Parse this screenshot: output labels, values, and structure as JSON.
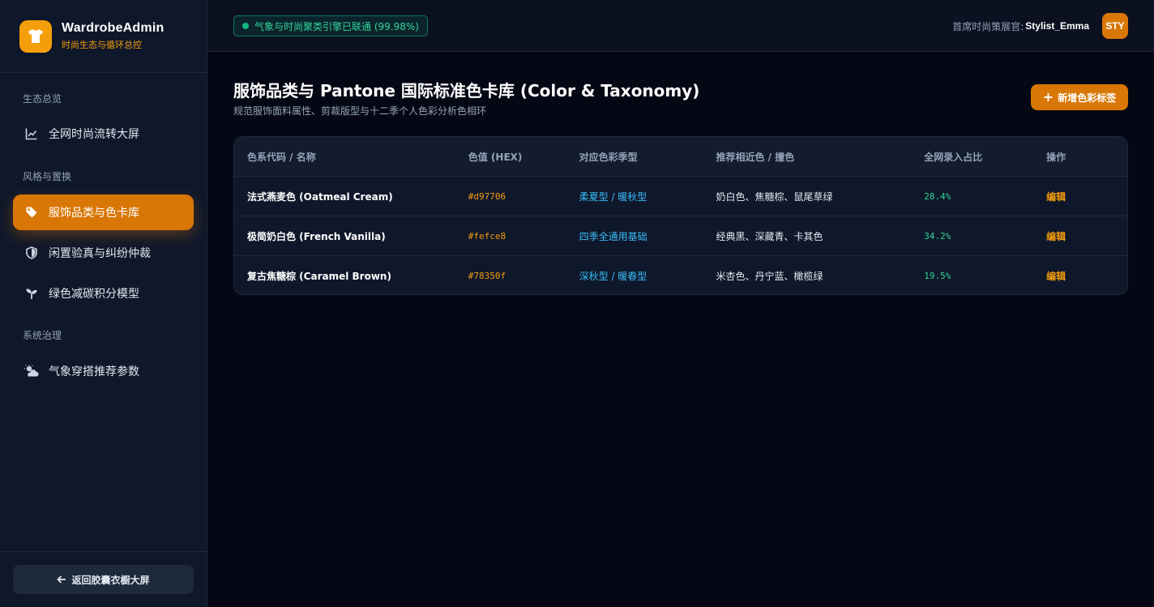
{
  "brand": {
    "title": "WardrobeAdmin",
    "subtitle": "时尚生态与循环总控"
  },
  "sidebar": {
    "sections": [
      {
        "label": "生态总览"
      },
      {
        "label": "风格与置换"
      },
      {
        "label": "系统治理"
      }
    ],
    "items": [
      {
        "label": "全网时尚流转大屏",
        "icon": "chart-line-icon"
      },
      {
        "label": "服饰品类与色卡库",
        "icon": "tag-icon",
        "active": true
      },
      {
        "label": "闲置验真与纠纷仲裁",
        "icon": "shield-icon"
      },
      {
        "label": "绿色减碳积分模型",
        "icon": "seedling-icon"
      },
      {
        "label": "气象穿搭推荐参数",
        "icon": "cloud-sun-icon"
      }
    ],
    "back_label": "返回胶囊衣橱大屏"
  },
  "topbar": {
    "status": "气象与时尚聚类引擎已联通 (99.98%)",
    "user_label": "首席时尚策展官:",
    "user_name": "Stylist_Emma",
    "avatar": "STY"
  },
  "page": {
    "title": "服饰品类与 Pantone 国际标准色卡库 (Color & Taxonomy)",
    "subtitle": "规范服饰面料属性、剪裁版型与十二季个人色彩分析色相环",
    "add_label": "新增色彩标签"
  },
  "table": {
    "headers": [
      "色系代码 / 名称",
      "色值 (HEX)",
      "对应色彩季型",
      "推荐相近色 / 撞色",
      "全网录入占比",
      "操作"
    ],
    "rows": [
      {
        "name": "法式燕麦色 (Oatmeal Cream)",
        "hex": "#d97706",
        "season": "柔夏型 / 暖秋型",
        "match": "奶白色、焦糖棕、鼠尾草绿",
        "pct": "28.4%",
        "action": "编辑"
      },
      {
        "name": "极简奶白色 (French Vanilla)",
        "hex": "#fefce8",
        "season": "四季全通用基础",
        "match": "经典黑、深藏青、卡其色",
        "pct": "34.2%",
        "action": "编辑"
      },
      {
        "name": "复古焦糖棕 (Caramel Brown)",
        "hex": "#78350f",
        "season": "深秋型 / 暖春型",
        "match": "米杏色、丹宁蓝、橄榄绿",
        "pct": "19.5%",
        "action": "编辑"
      }
    ]
  },
  "colors": {
    "accent": "#d97706",
    "success": "#34d399",
    "info": "#38bdf8"
  }
}
